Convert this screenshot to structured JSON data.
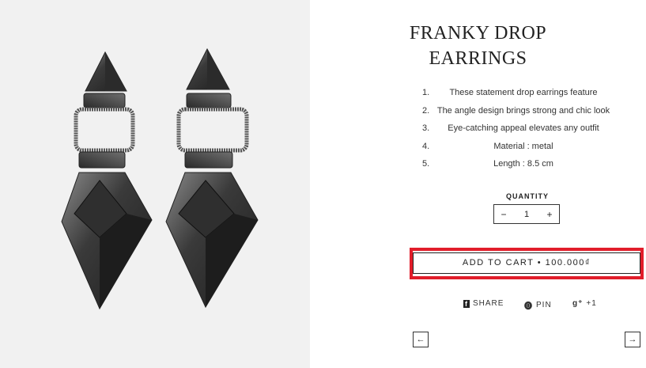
{
  "product": {
    "title_line1": "FRANKY DROP",
    "title_line2": "EARRINGS",
    "features": [
      {
        "num": "1.",
        "text": "These statement drop earrings feature"
      },
      {
        "num": "2.",
        "text": "The angle design brings strong and chic look"
      },
      {
        "num": "3.",
        "text": "Eye-catching appeal elevates any outfit"
      },
      {
        "num": "4.",
        "text": "Material : metal"
      },
      {
        "num": "5.",
        "text": "Length : 8.5 cm"
      }
    ]
  },
  "quantity": {
    "label": "QUANTITY",
    "minus": "−",
    "value": "1",
    "plus": "+"
  },
  "cart": {
    "label": "ADD TO CART • 100.000₫",
    "highlight_color": "#e11d2a"
  },
  "social": {
    "share": {
      "icon": "f",
      "label": "SHARE"
    },
    "pin": {
      "icon": "⓿",
      "label": "PIN"
    },
    "gplus": {
      "icon": "g⁺",
      "label": "+1"
    }
  },
  "nav": {
    "prev": "←",
    "next": "→"
  },
  "icons": [
    "facebook-icon",
    "pinterest-icon",
    "google-plus-icon",
    "arrow-left-icon",
    "arrow-right-icon"
  ]
}
